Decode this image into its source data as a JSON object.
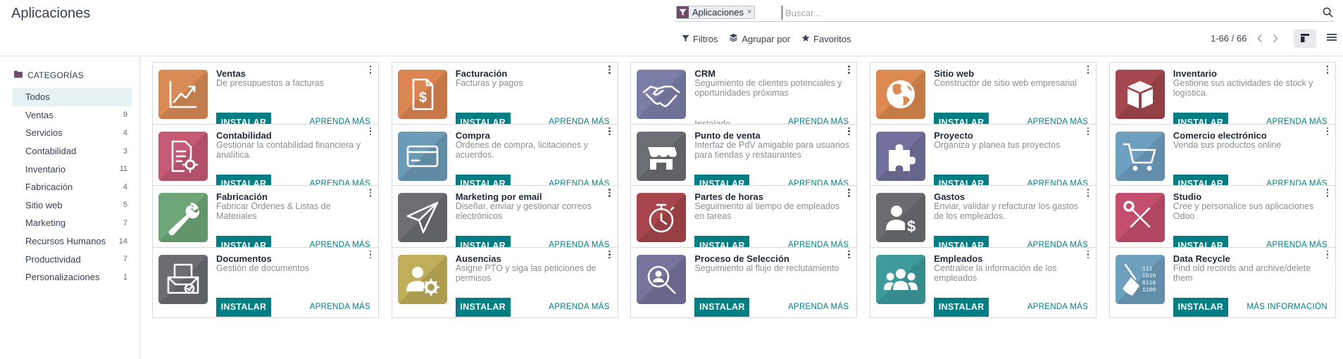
{
  "page": {
    "title": "Aplicaciones"
  },
  "search": {
    "facet_label": "Aplicaciones",
    "facet_remove": "×",
    "placeholder": "Buscar..."
  },
  "toolbar": {
    "filters_label": "Filtros",
    "group_by_label": "Agrupar por",
    "favorites_label": "Favoritos"
  },
  "pager": {
    "value": "1-66 / 66"
  },
  "sidebar": {
    "heading": "CATEGORÍAS",
    "items": [
      {
        "label": "Todos",
        "count": "",
        "active": true
      },
      {
        "label": "Ventas",
        "count": "9"
      },
      {
        "label": "Servicios",
        "count": "4"
      },
      {
        "label": "Contabilidad",
        "count": "3"
      },
      {
        "label": "Inventario",
        "count": "11"
      },
      {
        "label": "Fabricación",
        "count": "4"
      },
      {
        "label": "Sitio web",
        "count": "5"
      },
      {
        "label": "Marketing",
        "count": "7"
      },
      {
        "label": "Recursos Humanos",
        "count": "14"
      },
      {
        "label": "Productividad",
        "count": "7"
      },
      {
        "label": "Personalizaciones",
        "count": "1"
      }
    ]
  },
  "apps": [
    {
      "name": "Ventas",
      "summary": "De presupuestos a facturas",
      "icon": "chart-trend-icon",
      "color": "#d98b56",
      "action": "INSTALAR",
      "link": "APRENDA MÁS"
    },
    {
      "name": "Facturación",
      "summary": "Facturas y pagos",
      "icon": "invoice-dollar-icon",
      "color": "#dd8550",
      "action": "INSTALAR",
      "link": "APRENDA MÁS"
    },
    {
      "name": "CRM",
      "summary": "Seguimiento de clientes potenciales y oportunidades próximas",
      "icon": "handshake-icon",
      "color": "#7b7fa8",
      "status": "Instalado",
      "link": "APRENDA MÁS"
    },
    {
      "name": "Sitio web",
      "summary": "Constructor de sitio web empresarial",
      "icon": "globe-icon",
      "color": "#dc8a4f",
      "action": "INSTALAR",
      "link": "APRENDA MÁS"
    },
    {
      "name": "Inventario",
      "summary": "Gestione sus actividades de stock y logística.",
      "icon": "box-icon",
      "color": "#a4474f",
      "action": "INSTALAR",
      "link": "APRENDA MÁS"
    },
    {
      "name": "Contabilidad",
      "summary": "Gestionar la contabilidad financiera y analítica.",
      "icon": "accounting-doc-icon",
      "color": "#c65a74",
      "action": "INSTALAR",
      "link": "APRENDA MÁS"
    },
    {
      "name": "Compra",
      "summary": "Órdenes de compra, licitaciones y acuerdos.",
      "icon": "credit-card-icon",
      "color": "#6c9bb8",
      "action": "INSTALAR",
      "link": "APRENDA MÁS"
    },
    {
      "name": "Punto de venta",
      "summary": "Interfaz de PdV amigable para usuarios para tiendas y restaurantes",
      "icon": "store-icon",
      "color": "#6b6e72",
      "action": "INSTALAR",
      "link": "APRENDA MÁS"
    },
    {
      "name": "Proyecto",
      "summary": "Organiza y planea tus proyectos",
      "icon": "puzzle-icon",
      "color": "#72719e",
      "action": "INSTALAR",
      "link": "APRENDA MÁS"
    },
    {
      "name": "Comercio electrónico",
      "summary": "Venda sus productos online",
      "icon": "shopping-cart-icon",
      "color": "#6f9fbf",
      "action": "INSTALAR",
      "link": "APRENDA MÁS"
    },
    {
      "name": "Fabricación",
      "summary": "Fabricar Órdenes & Listas de Materiales",
      "icon": "wrench-icon",
      "color": "#6fa677",
      "action": "INSTALAR",
      "link": "APRENDA MÁS"
    },
    {
      "name": "Marketing por email",
      "summary": "Diseñar, enviar y gestionar correos electrónicos",
      "icon": "paper-plane-icon",
      "color": "#6c6e72",
      "action": "INSTALAR",
      "link": "APRENDA MÁS"
    },
    {
      "name": "Partes de horas",
      "summary": "Seguimiento al tiempo de empleados en tareas",
      "icon": "stopwatch-icon",
      "color": "#a7474b",
      "action": "INSTALAR",
      "link": "APRENDA MÁS"
    },
    {
      "name": "Gastos",
      "summary": "Enviar, validar y refacturar los gastos de los empleados.",
      "icon": "user-dollar-icon",
      "color": "#6a6c70",
      "action": "INSTALAR",
      "link": "APRENDA MÁS"
    },
    {
      "name": "Studio",
      "summary": "Cree y personalice sus aplicaciones Odoo",
      "icon": "tools-icon",
      "color": "#c44e6e",
      "action": "INSTALAR",
      "link": "APRENDA MÁS"
    },
    {
      "name": "Documentos",
      "summary": "Gestión de documentos",
      "icon": "document-tray-icon",
      "color": "#6b6d72",
      "action": "INSTALAR",
      "link": "APRENDA MÁS"
    },
    {
      "name": "Ausencias",
      "summary": "Asigne PTO y siga las peticiones de permisos",
      "icon": "user-gear-icon",
      "color": "#bfae5a",
      "action": "INSTALAR",
      "link": "APRENDA MÁS"
    },
    {
      "name": "Proceso de Selección",
      "summary": "Seguimiento al flujo de reclutamiento",
      "icon": "magnifier-user-icon",
      "color": "#75749c",
      "action": "INSTALAR",
      "link": "APRENDA MÁS"
    },
    {
      "name": "Empleados",
      "summary": "Centralice la información de los empleados",
      "icon": "users-group-icon",
      "color": "#3d9b9c",
      "action": "INSTALAR",
      "link": "APRENDA MÁS"
    },
    {
      "name": "Data Recycle",
      "summary": "Find old records and archive/delete them",
      "icon": "broom-binary-icon",
      "color": "#6e9fbd",
      "action": "INSTALAR",
      "link": "MÁS INFORMACIÓN"
    }
  ]
}
